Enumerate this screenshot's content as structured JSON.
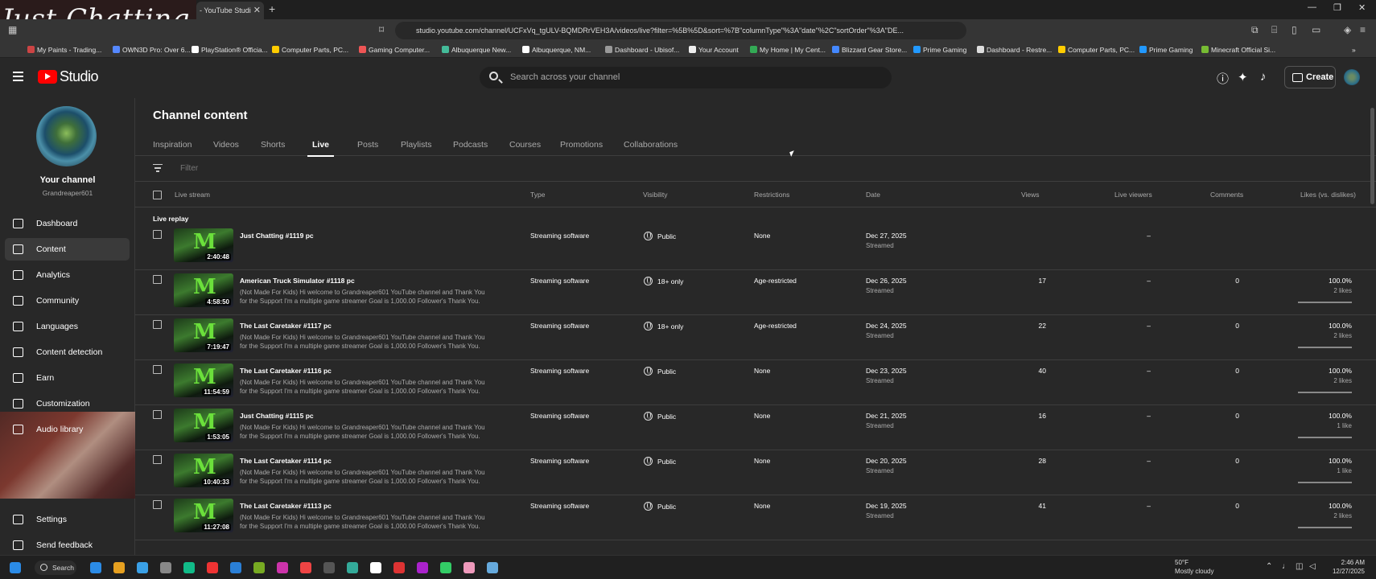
{
  "overlay": {
    "title": "Just Chatting"
  },
  "browser": {
    "tab_title": "- YouTube Studi",
    "tab_close": "✕",
    "new_tab": "+",
    "url": "studio.youtube.com/channel/UCFxVq_tgULV-BQMDRrVEH3A/videos/live?filter=%5B%5D&sort=%7B\"columnType\"%3A\"date\"%2C\"sortOrder\"%3A\"DE...",
    "bookmarks": [
      {
        "label": "My Paints - Trading...",
        "color": "#c44"
      },
      {
        "label": "OWN3D Pro: Over 6...",
        "color": "#58f"
      },
      {
        "label": "PlayStation® Officia...",
        "color": "#fff"
      },
      {
        "label": "Computer Parts, PC...",
        "color": "#fc0"
      },
      {
        "label": "Gaming Computer...",
        "color": "#e55"
      },
      {
        "label": "Albuquerque New...",
        "color": "#4b9"
      },
      {
        "label": "Albuquerque, NM...",
        "color": "#fff"
      },
      {
        "label": "Dashboard - Ubisof...",
        "color": "#999"
      },
      {
        "label": "Your Account",
        "color": "#eee"
      },
      {
        "label": "My Home | My Cent...",
        "color": "#3a5"
      },
      {
        "label": "Blizzard Gear Store...",
        "color": "#48f"
      },
      {
        "label": "Prime Gaming",
        "color": "#29f"
      },
      {
        "label": "Dashboard - Restre...",
        "color": "#ddd"
      },
      {
        "label": "Computer Parts, PC...",
        "color": "#fc0"
      },
      {
        "label": "Prime Gaming",
        "color": "#29f"
      },
      {
        "label": "Minecraft Official Si...",
        "color": "#7b3"
      }
    ]
  },
  "header": {
    "logo": "Studio",
    "search_placeholder": "Search across your channel",
    "create_label": "Create"
  },
  "sidebar": {
    "your_channel": "Your channel",
    "handle": "Grandreaper601",
    "items": [
      {
        "label": "Dashboard"
      },
      {
        "label": "Content"
      },
      {
        "label": "Analytics"
      },
      {
        "label": "Community"
      },
      {
        "label": "Languages"
      },
      {
        "label": "Content detection"
      },
      {
        "label": "Earn"
      },
      {
        "label": "Customization"
      },
      {
        "label": "Audio library"
      },
      {
        "label": "Settings"
      },
      {
        "label": "Send feedback"
      }
    ]
  },
  "main": {
    "title": "Channel content",
    "tabs": [
      "Inspiration",
      "Videos",
      "Shorts",
      "Live",
      "Posts",
      "Playlists",
      "Podcasts",
      "Courses",
      "Promotions",
      "Collaborations"
    ],
    "filter_placeholder": "Filter",
    "columns": {
      "live_stream": "Live stream",
      "type": "Type",
      "visibility": "Visibility",
      "restrictions": "Restrictions",
      "date": "Date",
      "views": "Views",
      "live_viewers": "Live viewers",
      "comments": "Comments",
      "likes": "Likes (vs. dislikes)"
    },
    "group_label": "Live replay",
    "rows": [
      {
        "title": "Just Chatting #1119 pc",
        "desc": "",
        "duration": "2:40:48",
        "type": "Streaming software",
        "visibility": "Public",
        "restrictions": "None",
        "date": "Dec 27, 2025",
        "date_sub": "Streamed",
        "views": "",
        "live_viewers": "–",
        "comments": "",
        "likes": "",
        "likes_sub": ""
      },
      {
        "title": "American Truck Simulator #1118 pc",
        "desc": "(Not Made For Kids) Hi welcome to Grandreaper601 YouTube channel and Thank You for the Support I'm a multiple game streamer Goal is 1,000.00 Follower's Thank You. Pc...",
        "duration": "4:58:50",
        "type": "Streaming software",
        "visibility": "18+ only",
        "restrictions": "Age-restricted",
        "date": "Dec 26, 2025",
        "date_sub": "Streamed",
        "views": "17",
        "live_viewers": "–",
        "comments": "0",
        "likes": "100.0%",
        "likes_sub": "2 likes"
      },
      {
        "title": "The Last Caretaker #1117 pc",
        "desc": "(Not Made For Kids) Hi welcome to Grandreaper601 YouTube channel and Thank You for the Support I'm a multiple game streamer Goal is 1,000.00 Follower's Thank You. Pc...",
        "duration": "7:19:47",
        "type": "Streaming software",
        "visibility": "18+ only",
        "restrictions": "Age-restricted",
        "date": "Dec 24, 2025",
        "date_sub": "Streamed",
        "views": "22",
        "live_viewers": "–",
        "comments": "0",
        "likes": "100.0%",
        "likes_sub": "2 likes"
      },
      {
        "title": "The Last Caretaker #1116 pc",
        "desc": "(Not Made For Kids) Hi welcome to Grandreaper601 YouTube channel and Thank You for the Support I'm a multiple game streamer Goal is 1,000.00 Follower's Thank You. Pc...",
        "duration": "11:54:59",
        "type": "Streaming software",
        "visibility": "Public",
        "restrictions": "None",
        "date": "Dec 23, 2025",
        "date_sub": "Streamed",
        "views": "40",
        "live_viewers": "–",
        "comments": "0",
        "likes": "100.0%",
        "likes_sub": "2 likes"
      },
      {
        "title": "Just Chatting #1115 pc",
        "desc": "(Not Made For Kids) Hi welcome to Grandreaper601 YouTube channel and Thank You for the Support I'm a multiple game streamer Goal is 1,000.00 Follower's Thank You. Pc...",
        "duration": "1:53:05",
        "type": "Streaming software",
        "visibility": "Public",
        "restrictions": "None",
        "date": "Dec 21, 2025",
        "date_sub": "Streamed",
        "views": "16",
        "live_viewers": "–",
        "comments": "0",
        "likes": "100.0%",
        "likes_sub": "1 like"
      },
      {
        "title": "The Last Caretaker #1114 pc",
        "desc": "(Not Made For Kids) Hi welcome to Grandreaper601 YouTube channel and Thank You for the Support I'm a multiple game streamer Goal is 1,000.00 Follower's Thank You. Pc...",
        "duration": "10:40:33",
        "type": "Streaming software",
        "visibility": "Public",
        "restrictions": "None",
        "date": "Dec 20, 2025",
        "date_sub": "Streamed",
        "views": "28",
        "live_viewers": "–",
        "comments": "0",
        "likes": "100.0%",
        "likes_sub": "1 like"
      },
      {
        "title": "The Last Caretaker #1113 pc",
        "desc": "(Not Made For Kids) Hi welcome to Grandreaper601 YouTube channel and Thank You for the Support I'm a multiple game streamer Goal is 1,000.00 Follower's Thank You. Pc...",
        "duration": "11:27:08",
        "type": "Streaming software",
        "visibility": "Public",
        "restrictions": "None",
        "date": "Dec 19, 2025",
        "date_sub": "Streamed",
        "views": "41",
        "live_viewers": "–",
        "comments": "0",
        "likes": "100.0%",
        "likes_sub": "2 likes"
      }
    ]
  },
  "taskbar": {
    "search_label": "Search",
    "weather_temp": "50°F",
    "weather_desc": "Mostly cloudy",
    "time": "2:46 AM",
    "date": "12/27/2025"
  }
}
